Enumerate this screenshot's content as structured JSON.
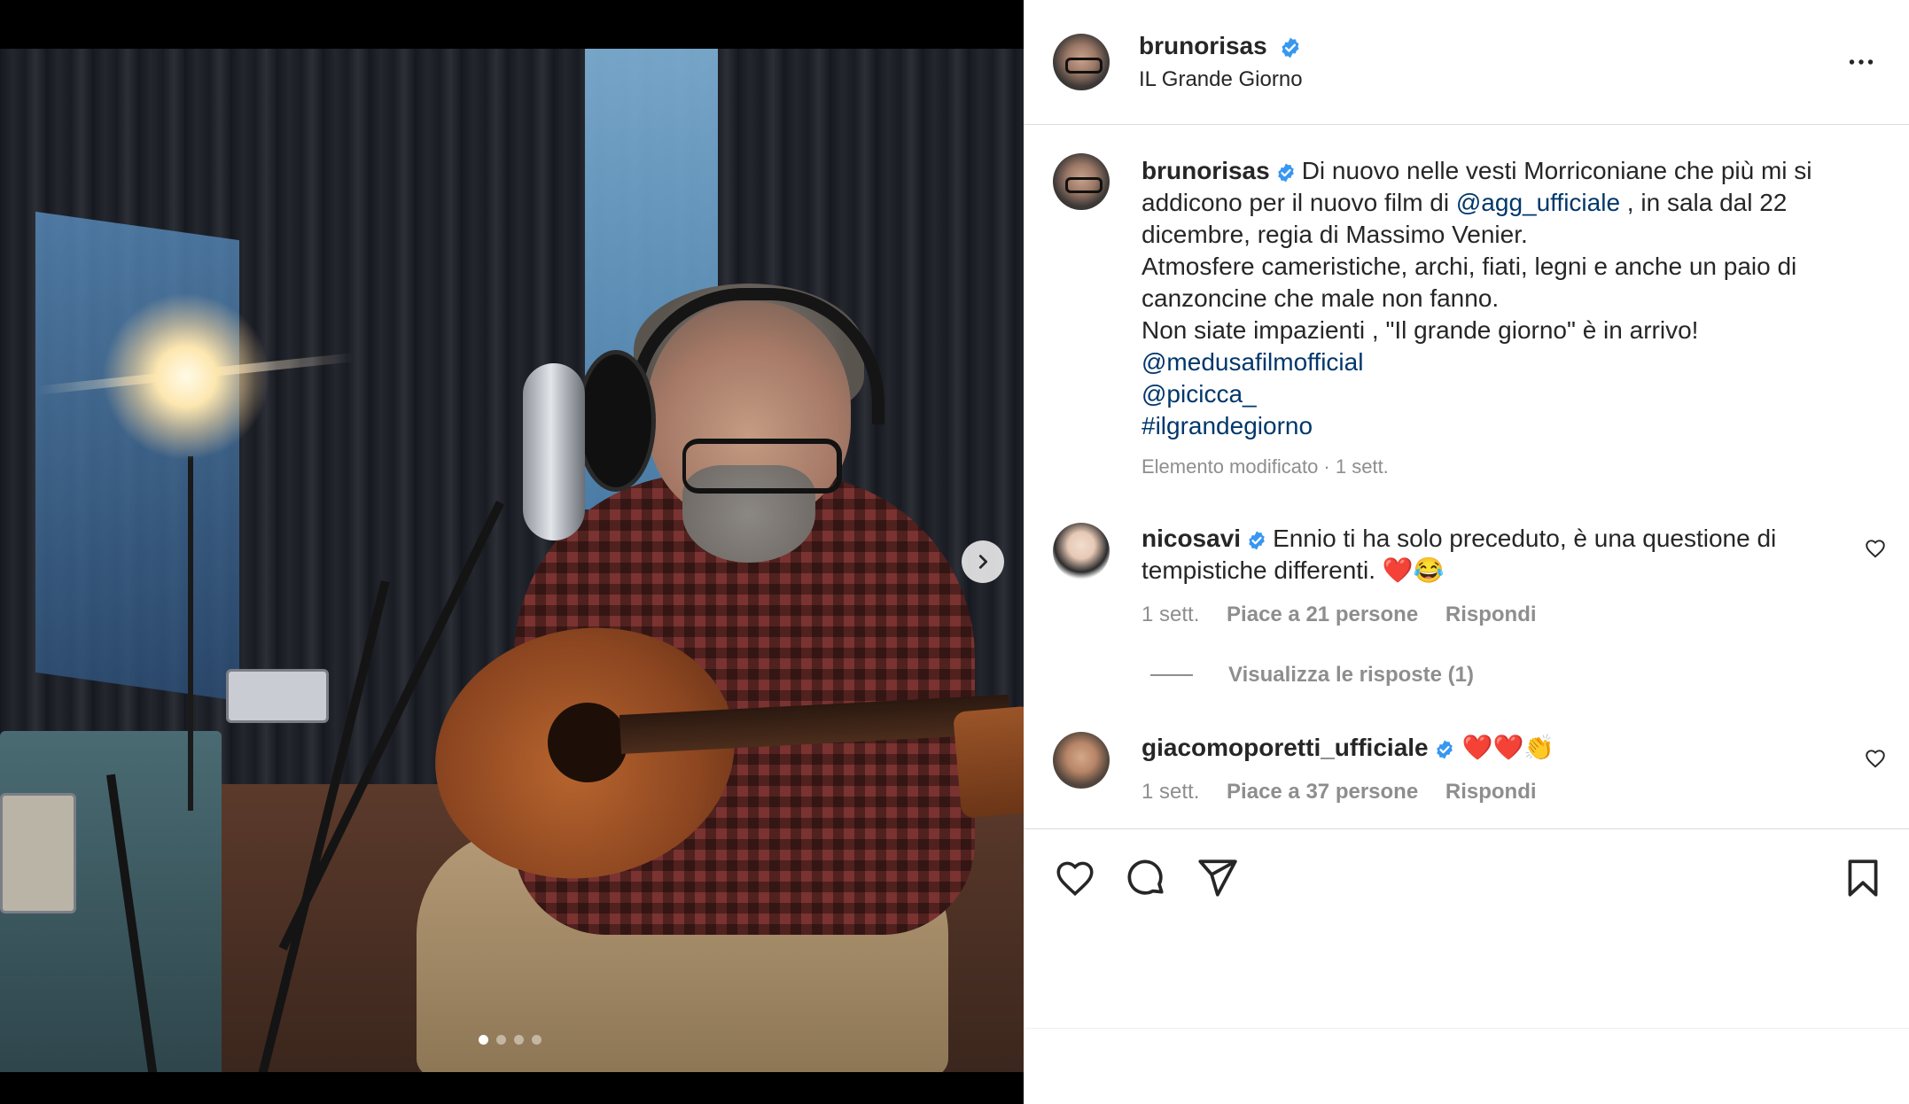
{
  "post": {
    "author": "brunorisas",
    "subtitle": "IL Grande Giorno",
    "media_pages": 4,
    "media_current_page": 1
  },
  "caption": {
    "author": "brunorisas",
    "text_1": "Di nuovo nelle vesti Morriconiane che più mi si addicono per il nuovo film di ",
    "mention_1": "@agg_ufficiale",
    "text_2": " , in sala dal 22 dicembre, regia di Massimo Venier.",
    "text_3": "Atmosfere cameristiche, archi, fiati, legni e anche un paio di canzoncine che male non fanno.",
    "text_4": "Non siate impazienti , \"Il grande giorno\" è in arrivo!",
    "mention_2": "@medusafilmofficial",
    "mention_3": "@picicca_",
    "hashtag": "#ilgrandegiorno",
    "meta": "Elemento modificato · 1 sett."
  },
  "comments": [
    {
      "author": "nicosavi",
      "text": "Ennio ti ha solo preceduto, è una questione di tempistiche differenti. ❤️😂",
      "time": "1 sett.",
      "likes": "Piace a 21 persone",
      "reply": "Rispondi",
      "view_replies": "Visualizza le risposte (1)"
    },
    {
      "author": "giacomoporetti_ufficiale",
      "text": "❤️❤️👏",
      "time": "1 sett.",
      "likes": "Piace a 37 persone",
      "reply": "Rispondi"
    }
  ],
  "colors": {
    "text": "#262626",
    "secondary": "#8e8e8e",
    "link": "#00376b",
    "verified": "#3897f0"
  },
  "icons": [
    "more-options-icon",
    "verified-badge-icon",
    "chevron-right-icon",
    "heart-icon",
    "comment-icon",
    "share-icon",
    "bookmark-icon"
  ]
}
